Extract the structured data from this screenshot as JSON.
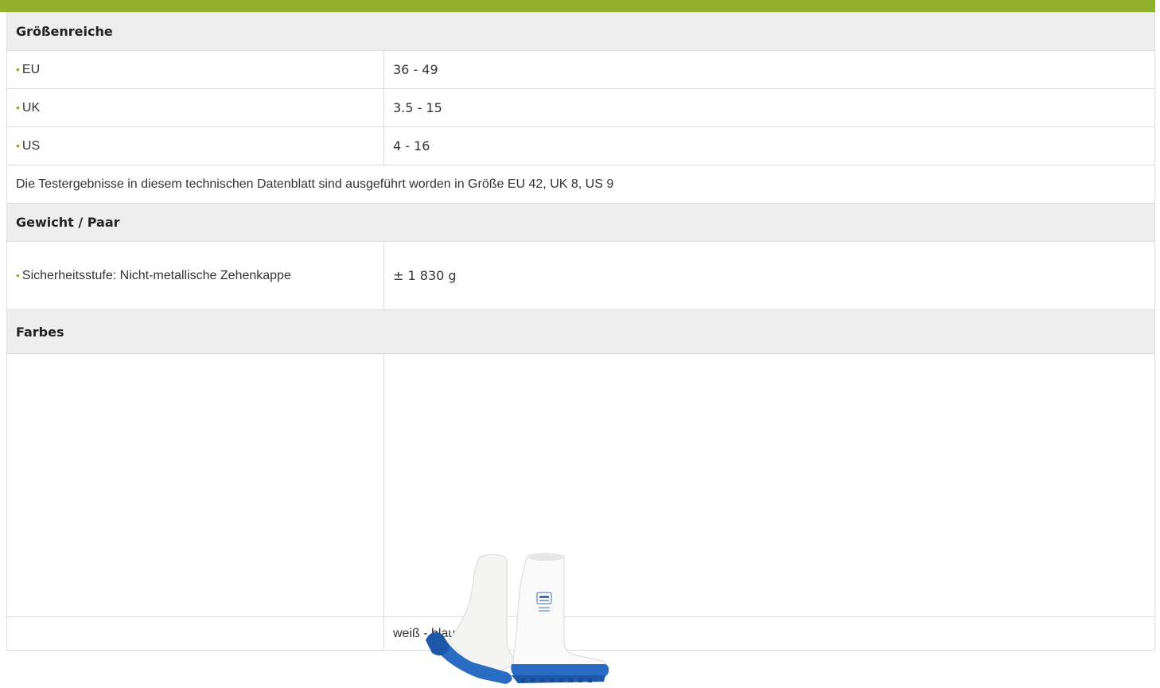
{
  "colors": {
    "accent": "#92b12a",
    "section_bg": "#eeeeee",
    "border": "#dcdcdc",
    "sole_blue": "#2a6cc4"
  },
  "sizes": {
    "heading": "Größenreiche",
    "rows": [
      {
        "label": "EU",
        "value": "36 - 49"
      },
      {
        "label": "UK",
        "value": "3.5 - 15"
      },
      {
        "label": "US",
        "value": "4 - 16"
      }
    ],
    "note": "Die Testergebnisse in diesem technischen Datenblatt sind ausgeführt worden in Größe EU 42, UK 8, US 9"
  },
  "weight": {
    "heading": "Gewicht / Paar",
    "label": "Sicherheitsstufe: Nicht-metallische Zehenkappe",
    "value": "± 1 830 g"
  },
  "colors_section": {
    "heading": "Farbes",
    "image_icon": "white-blue-rubber-boots-image",
    "color_name": "weiß - blau"
  }
}
